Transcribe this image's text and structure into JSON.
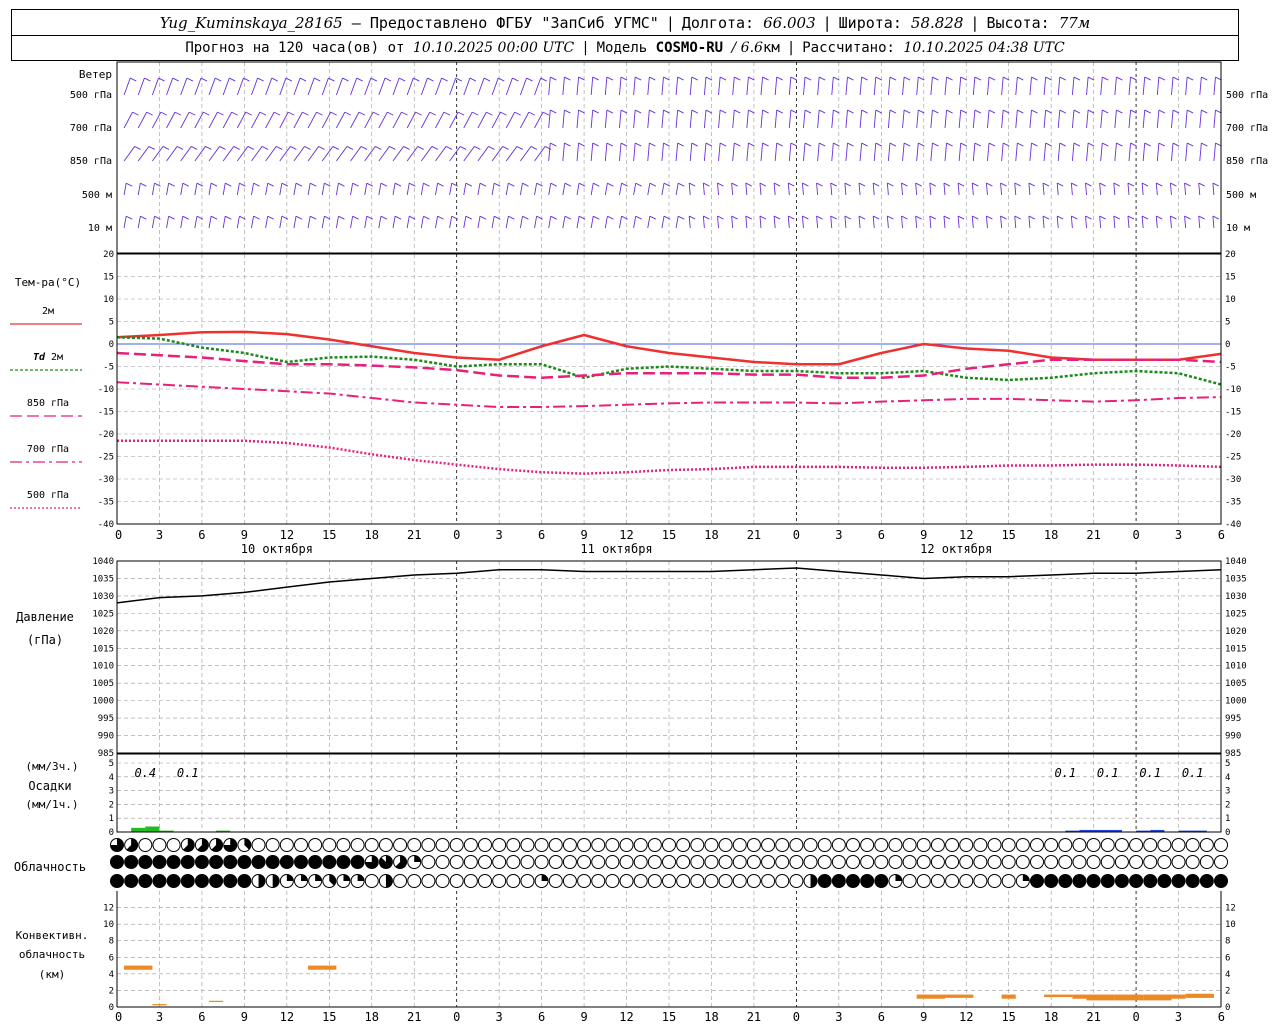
{
  "header": {
    "station": "Yug_Kuminskaya_28165",
    "provided": "— Предоставлено ФГБУ \"ЗапСиб УГМС\"",
    "lon_label": "Долгота:",
    "lon_value": "66.003",
    "lat_label": "Широта:",
    "lat_value": "58.828",
    "alt_label": "Высота:",
    "alt_value": "77м",
    "forecast_prefix": "Прогноз на 120 часа(ов) от",
    "forecast_time": "10.10.2025 00:00 UTC",
    "model_label": "Модель",
    "model_name": "COSMO-RU",
    "model_res": "/ 6.6",
    "model_res_unit": "км",
    "calc_label": "Рассчитано:",
    "calc_time": "10.10.2025 04:38 UTC"
  },
  "colors": {
    "wind": "#6a2fd6",
    "t2m": "#ee3030",
    "td2m": "#1a8a1a",
    "t850": "#e8207a",
    "t700": "#e8207a",
    "t500": "#e8207a",
    "pressure": "#000000",
    "precip_rain": "#22bb22",
    "precip_snow": "#2244dd",
    "convective": "#ee8822",
    "zero_line": "#4060e0",
    "grid": "#9a9a9a"
  },
  "time_axis": {
    "hour_labels": [
      "0",
      "3",
      "6",
      "9",
      "12",
      "15",
      "18",
      "21",
      "0",
      "3",
      "6",
      "9",
      "12",
      "15",
      "18",
      "21",
      "0",
      "3",
      "6",
      "9",
      "12",
      "15",
      "18",
      "21",
      "0",
      "3",
      "6"
    ],
    "day_labels": [
      "10 октября",
      "11 октября",
      "12 октября"
    ]
  },
  "wind_panel": {
    "title": "Ветер",
    "levels": [
      "500 гПа",
      "700 гПа",
      "850 гПа",
      "500 м",
      "10  м"
    ],
    "right_levels": [
      "500 гПа",
      "700 гПа",
      "850 гПа",
      "500 м",
      "10  м"
    ]
  },
  "legend": {
    "temp_title": "Тем-ра(°С)",
    "t2m": "2м",
    "td_sym": "Td",
    "td_lvl": "2м",
    "t850": "850 гПа",
    "t700": "700 гПа",
    "t500": "500 гПа"
  },
  "pressure_panel": {
    "title_1": "Давление",
    "title_2": "(гПа)"
  },
  "precip_panel": {
    "title_1": "(мм/3ч.)",
    "title_2": "Осадки",
    "title_3": "(мм/1ч.)"
  },
  "cloud_panel": {
    "title": "Облачность"
  },
  "conv_panel": {
    "title_1": "Конвективн.",
    "title_2": "облачность",
    "title_3": "(км)"
  },
  "chart_data": [
    {
      "type": "line",
      "name": "temperature",
      "x_hours": [
        0,
        3,
        6,
        9,
        12,
        15,
        18,
        21,
        24,
        27,
        30,
        33,
        36,
        39,
        42,
        45,
        48,
        51,
        54,
        57,
        60,
        63,
        66,
        69,
        72,
        75,
        78
      ],
      "ylim": [
        -40,
        20
      ],
      "yticks": [
        20,
        15,
        10,
        5,
        0,
        -5,
        -10,
        -15,
        -20,
        -25,
        -30,
        -35,
        -40
      ],
      "series": [
        {
          "name": "2м",
          "key": "t2m",
          "values": [
            1.5,
            2.0,
            2.6,
            2.7,
            2.2,
            1.0,
            -0.5,
            -2.0,
            -3.0,
            -3.5,
            -0.5,
            2.0,
            -0.5,
            -2.0,
            -3.0,
            -4.0,
            -4.5,
            -4.5,
            -2.0,
            0.0,
            -1.0,
            -1.5,
            -3.0,
            -3.5,
            -3.5,
            -3.5,
            -2.2
          ]
        },
        {
          "name": "Td 2м",
          "key": "td2m",
          "values": [
            1.5,
            1.2,
            -0.8,
            -2.0,
            -4.0,
            -3.0,
            -2.8,
            -3.5,
            -5.0,
            -4.5,
            -4.5,
            -7.5,
            -5.5,
            -5.0,
            -5.5,
            -6.0,
            -6.0,
            -6.5,
            -6.5,
            -6.0,
            -7.5,
            -8.0,
            -7.5,
            -6.5,
            -6.0,
            -6.5,
            -9.0
          ]
        },
        {
          "name": "850 гПа",
          "key": "t850",
          "values": [
            -2.0,
            -2.5,
            -3.0,
            -3.8,
            -4.5,
            -4.5,
            -4.8,
            -5.2,
            -5.8,
            -7.0,
            -7.5,
            -7.0,
            -6.5,
            -6.5,
            -6.5,
            -6.8,
            -6.8,
            -7.5,
            -7.5,
            -7.0,
            -5.5,
            -4.5,
            -3.5,
            -3.5,
            -3.5,
            -3.5,
            -4.0
          ]
        },
        {
          "name": "700 гПа",
          "key": "t700",
          "values": [
            -8.5,
            -9.0,
            -9.5,
            -10.0,
            -10.5,
            -11.0,
            -12.0,
            -13.0,
            -13.5,
            -14.0,
            -14.0,
            -13.8,
            -13.5,
            -13.2,
            -13.0,
            -13.0,
            -13.0,
            -13.2,
            -12.8,
            -12.5,
            -12.2,
            -12.2,
            -12.5,
            -12.8,
            -12.5,
            -12.0,
            -11.8
          ]
        },
        {
          "name": "500 гПа",
          "key": "t500",
          "values": [
            -21.5,
            -21.5,
            -21.5,
            -21.5,
            -22.0,
            -23.0,
            -24.5,
            -25.8,
            -26.8,
            -27.8,
            -28.5,
            -28.8,
            -28.5,
            -28.0,
            -27.8,
            -27.3,
            -27.3,
            -27.3,
            -27.5,
            -27.5,
            -27.3,
            -27.0,
            -27.0,
            -26.8,
            -26.8,
            -27.0,
            -27.3
          ]
        }
      ]
    },
    {
      "type": "line",
      "name": "pressure",
      "x_hours": [
        0,
        3,
        6,
        9,
        12,
        15,
        18,
        21,
        24,
        27,
        30,
        33,
        36,
        39,
        42,
        45,
        48,
        51,
        54,
        57,
        60,
        63,
        66,
        69,
        72,
        75,
        78
      ],
      "ylim": [
        985,
        1040
      ],
      "yticks": [
        1040,
        1035,
        1030,
        1025,
        1020,
        1015,
        1010,
        1005,
        1000,
        995,
        990,
        985
      ],
      "series": [
        {
          "name": "Давление",
          "key": "pressure",
          "values": [
            1028.0,
            1029.5,
            1030.0,
            1031.0,
            1032.5,
            1034.0,
            1035.0,
            1036.0,
            1036.5,
            1037.5,
            1037.5,
            1037.0,
            1037.0,
            1037.0,
            1037.0,
            1037.5,
            1038.0,
            1037.0,
            1036.0,
            1035.0,
            1035.5,
            1035.5,
            1036.0,
            1036.5,
            1036.5,
            1037.0,
            1037.5
          ]
        }
      ]
    },
    {
      "type": "bar",
      "name": "precipitation",
      "ylim": [
        0,
        5
      ],
      "yticks": [
        5,
        4,
        3,
        2,
        1,
        0
      ],
      "labels": [
        {
          "hour": 2,
          "text": "0.4"
        },
        {
          "hour": 5,
          "text": "0.1"
        },
        {
          "hour": 67,
          "text": "0.1"
        },
        {
          "hour": 70,
          "text": "0.1"
        },
        {
          "hour": 73,
          "text": "0.1"
        },
        {
          "hour": 76,
          "text": "0.1"
        }
      ],
      "bars": [
        {
          "start": 1,
          "end": 2,
          "value": 0.3,
          "kind": "rain"
        },
        {
          "start": 2,
          "end": 3,
          "value": 0.4,
          "kind": "rain"
        },
        {
          "start": 3,
          "end": 4,
          "value": 0.1,
          "kind": "rain"
        },
        {
          "start": 7,
          "end": 8,
          "value": 0.1,
          "kind": "rain"
        },
        {
          "start": 67,
          "end": 68,
          "value": 0.1,
          "kind": "snow"
        },
        {
          "start": 68,
          "end": 71,
          "value": 0.15,
          "kind": "snow"
        },
        {
          "start": 72,
          "end": 73,
          "value": 0.1,
          "kind": "snow"
        },
        {
          "start": 73,
          "end": 74,
          "value": 0.15,
          "kind": "snow"
        },
        {
          "start": 75,
          "end": 77,
          "value": 0.1,
          "kind": "snow"
        }
      ]
    },
    {
      "type": "bar",
      "name": "convective_cloud",
      "ylim": [
        0,
        14
      ],
      "yticks": [
        12,
        10,
        8,
        6,
        4,
        2,
        0
      ],
      "bars": [
        {
          "start": 0.5,
          "end": 2.5,
          "bottom": 4.5,
          "top": 5.0
        },
        {
          "start": 2.5,
          "end": 3.5,
          "bottom": 0.2,
          "top": 0.35
        },
        {
          "start": 6.5,
          "end": 7.5,
          "bottom": 0.6,
          "top": 0.75
        },
        {
          "start": 13.5,
          "end": 15.5,
          "bottom": 4.5,
          "top": 5.0
        },
        {
          "start": 56.5,
          "end": 58.5,
          "bottom": 1.0,
          "top": 1.5
        },
        {
          "start": 58.5,
          "end": 60.5,
          "bottom": 1.1,
          "top": 1.5
        },
        {
          "start": 62.5,
          "end": 63.5,
          "bottom": 1.0,
          "top": 1.5
        },
        {
          "start": 65.5,
          "end": 67.5,
          "bottom": 1.2,
          "top": 1.5
        },
        {
          "start": 67.5,
          "end": 68.5,
          "bottom": 1.0,
          "top": 1.5
        },
        {
          "start": 68.5,
          "end": 70.5,
          "bottom": 0.8,
          "top": 1.5
        },
        {
          "start": 70.5,
          "end": 72.5,
          "bottom": 0.8,
          "top": 1.5
        },
        {
          "start": 72.5,
          "end": 74.5,
          "bottom": 0.8,
          "top": 1.5
        },
        {
          "start": 74.5,
          "end": 75.5,
          "bottom": 1.0,
          "top": 1.5
        },
        {
          "start": 75.5,
          "end": 77.5,
          "bottom": 1.1,
          "top": 1.6
        }
      ]
    },
    {
      "type": "table",
      "name": "cloudiness",
      "rows": [
        [
          6,
          5,
          0,
          0,
          0,
          5,
          5,
          5,
          6,
          3,
          0,
          0,
          0,
          0,
          0,
          0,
          0,
          0,
          0,
          0,
          0,
          0,
          0,
          0,
          0,
          0,
          0,
          0,
          0,
          0,
          0,
          0,
          0,
          0,
          0,
          0,
          0,
          0,
          0,
          0,
          0,
          0,
          0,
          0,
          0,
          0,
          0,
          0,
          0,
          0,
          0,
          0,
          0,
          0,
          0,
          0,
          0,
          0,
          0,
          0,
          0,
          0,
          0,
          0,
          0,
          0,
          0,
          0,
          0,
          0,
          0,
          0,
          0,
          0,
          0,
          0,
          0,
          0,
          0
        ],
        [
          8,
          8,
          8,
          8,
          8,
          8,
          8,
          8,
          8,
          8,
          8,
          8,
          8,
          8,
          8,
          8,
          8,
          8,
          6,
          7,
          5,
          2,
          0,
          0,
          0,
          0,
          0,
          0,
          0,
          0,
          0,
          0,
          0,
          0,
          0,
          0,
          0,
          0,
          0,
          0,
          0,
          0,
          0,
          0,
          0,
          0,
          0,
          0,
          0,
          0,
          0,
          0,
          0,
          0,
          0,
          0,
          0,
          0,
          0,
          0,
          0,
          0,
          0,
          0,
          0,
          0,
          0,
          0,
          0,
          0,
          0,
          0,
          0,
          0,
          0,
          0,
          0,
          0,
          0
        ],
        [
          8,
          8,
          8,
          8,
          8,
          8,
          8,
          8,
          8,
          8,
          4,
          4,
          2,
          2,
          2,
          3,
          2,
          2,
          0,
          4,
          0,
          0,
          0,
          0,
          0,
          0,
          0,
          0,
          0,
          0,
          2,
          0,
          0,
          0,
          0,
          0,
          0,
          0,
          0,
          0,
          0,
          0,
          0,
          0,
          0,
          0,
          0,
          0,
          0,
          4,
          8,
          8,
          8,
          8,
          8,
          2,
          0,
          0,
          0,
          0,
          0,
          0,
          0,
          0,
          2,
          8,
          8,
          8,
          8,
          8,
          8,
          8,
          8,
          8,
          8,
          8,
          8,
          8,
          8
        ]
      ]
    }
  ]
}
